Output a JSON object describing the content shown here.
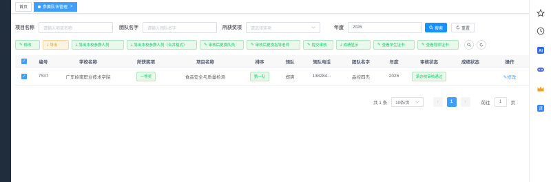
{
  "tags": {
    "home": "首页",
    "active": "参赛队伍管理"
  },
  "search": {
    "project_label": "项目名称",
    "project_placeholder": "请输入项目名称",
    "team_label": "团队名字",
    "team_placeholder": "请输入团队名字",
    "award_label": "所获奖项",
    "award_placeholder": "请选择奖项",
    "year_label": "年度",
    "year_value": "2026",
    "search_button": "搜索",
    "reset_button": "重置"
  },
  "toolbar": {
    "edit": "修改",
    "export": "导出",
    "export_members": "导出本校参赛人员",
    "export_members_merged": "导出本校参赛人员（合并格式）",
    "review_change_members": "审核后更换队员",
    "review_change_teachers": "审核后更换指导老师",
    "submit_review": "提交审核",
    "show_score": "成绩显示",
    "view_student_cert": "查看学生证书",
    "view_teacher_cert": "查看导师证书"
  },
  "table": {
    "headers": [
      "编号",
      "学校名称",
      "所获奖项",
      "项目名称",
      "排序",
      "领队",
      "领队电话",
      "团队名字",
      "年度",
      "审核状态",
      "成绩状态",
      "操作"
    ],
    "rows": [
      {
        "id": "7537",
        "school": "广东岭南职业技术学院",
        "award": "一等奖",
        "project": "食品安全与质量检测",
        "order": "第一队",
        "leader": "郑爽",
        "phone": "138284...",
        "team": "品控四杰",
        "year": "2026",
        "review_status": "承办校审核通过",
        "score_status": "",
        "action": "修改"
      }
    ]
  },
  "pagination": {
    "total": "共 1 条",
    "page_size": "10条/页",
    "current": "1",
    "goto_label": "前往",
    "goto_value": "1",
    "page_suffix": "页"
  },
  "colors": {
    "primary": "#409eff",
    "success": "#13ce66",
    "warning": "#e6a23c",
    "sidebar": "#1f2d3d"
  }
}
